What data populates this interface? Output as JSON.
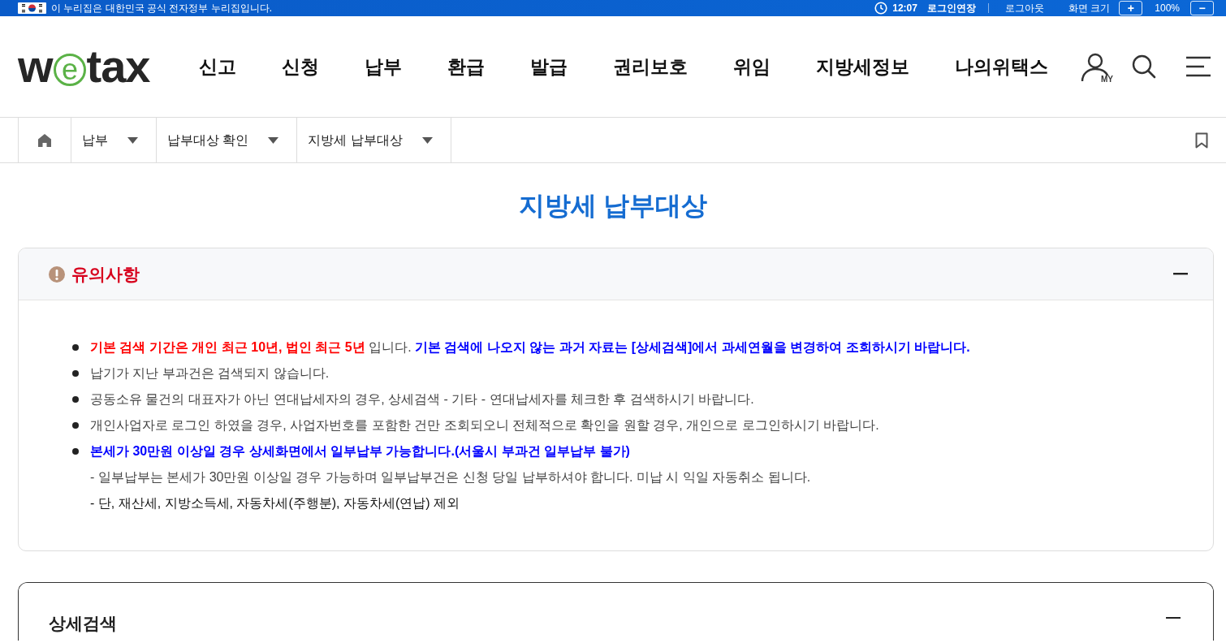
{
  "top_bar": {
    "notice": "이 누리집은 대한민국 공식 전자정부 누리집입니다.",
    "timer": "12:07",
    "extend_button": "로그인연장",
    "logout_link": "로그아웃",
    "zoom_label": "화면 크기",
    "zoom_in_button": "+",
    "zoom_level": "100%",
    "zoom_out_button": "−"
  },
  "header": {
    "logo": {
      "prefix": "w",
      "ring_letter": "e",
      "suffix": "tax"
    },
    "nav": [
      "신고",
      "신청",
      "납부",
      "환급",
      "발급",
      "권리보호",
      "위임",
      "지방세정보",
      "나의위택스"
    ],
    "my_label": "MY"
  },
  "breadcrumb": [
    "납부",
    "납부대상 확인",
    "지방세 납부대상"
  ],
  "page_title": "지방세 납부대상",
  "panels": [
    {
      "kind": "notice",
      "title": "유의사항",
      "expanded": true,
      "items": [
        {
          "kind": "bullet",
          "parts": [
            {
              "text": "기본 검색 기간은 개인 최근 10년, 법인 최근 5년",
              "kind": "warning"
            },
            {
              "text": " 입니다. ",
              "kind": "plain"
            },
            {
              "text": "기본 검색에 나오지 않는 과거 자료는 [상세검색]에서 과세연월을 변경하여 조회하시기 바랍니다.",
              "kind": "highlight"
            }
          ]
        },
        {
          "kind": "bullet",
          "parts": [
            {
              "text": "납기가 지난 부과건은 검색되지 않습니다.",
              "kind": "plain"
            }
          ]
        },
        {
          "kind": "bullet",
          "parts": [
            {
              "text": "공동소유 물건의 대표자가 아닌 연대납세자의 경우, 상세검색 - 기타 - 연대납세자를 체크한 후 검색하시기 바랍니다.",
              "kind": "plain"
            }
          ]
        },
        {
          "kind": "bullet",
          "parts": [
            {
              "text": "개인사업자로 로그인 하였을 경우, 사업자번호를 포함한 건만 조회되오니 전체적으로 확인을 원할 경우, 개인으로 로그인하시기 바랍니다.",
              "kind": "plain"
            }
          ]
        },
        {
          "kind": "bullet",
          "parts": [
            {
              "text": "본세가 30만원 이상일 경우 상세화면에서 일부납부 가능합니다.(서울시 부과건 일부납부 불가)",
              "kind": "highlight"
            }
          ]
        },
        {
          "kind": "sub",
          "parts": [
            {
              "text": "- 일부납부는 본세가 30만원 이상일 경우 가능하며 일부납부건은 신청 당일 납부하셔야 합니다. 미납 시 익일 자동취소 됩니다.",
              "kind": "plain"
            }
          ]
        },
        {
          "kind": "sub",
          "parts": [
            {
              "text": "- 단, 재산세, 지방소득세, 자동차세(주행분), 자동차세(연납) 제외",
              "kind": "dark"
            }
          ]
        }
      ]
    },
    {
      "kind": "search",
      "title": "상세검색",
      "expanded": true
    }
  ]
}
